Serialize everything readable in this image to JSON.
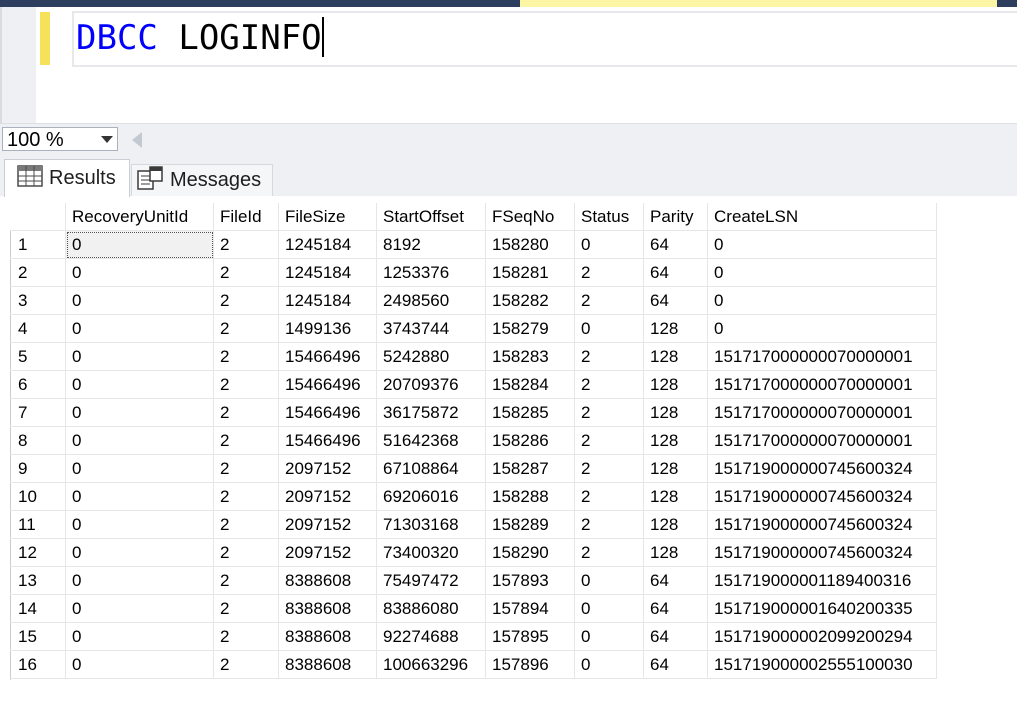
{
  "editor": {
    "keyword": "DBCC",
    "rest": " LOGINFO"
  },
  "zoom": {
    "value": "100 %"
  },
  "tabs": {
    "results": "Results",
    "messages": "Messages"
  },
  "colors": {
    "keyword": "#0000ff",
    "change_bar": "#f5e15a",
    "top_strip": "#2d3e5e"
  },
  "grid": {
    "columns": [
      "",
      "RecoveryUnitId",
      "FileId",
      "FileSize",
      "StartOffset",
      "FSeqNo",
      "Status",
      "Parity",
      "CreateLSN"
    ],
    "rows": [
      [
        "1",
        "0",
        "2",
        "1245184",
        "8192",
        "158280",
        "0",
        "64",
        "0"
      ],
      [
        "2",
        "0",
        "2",
        "1245184",
        "1253376",
        "158281",
        "2",
        "64",
        "0"
      ],
      [
        "3",
        "0",
        "2",
        "1245184",
        "2498560",
        "158282",
        "2",
        "64",
        "0"
      ],
      [
        "4",
        "0",
        "2",
        "1499136",
        "3743744",
        "158279",
        "0",
        "128",
        "0"
      ],
      [
        "5",
        "0",
        "2",
        "15466496",
        "5242880",
        "158283",
        "2",
        "128",
        "151717000000070000001"
      ],
      [
        "6",
        "0",
        "2",
        "15466496",
        "20709376",
        "158284",
        "2",
        "128",
        "151717000000070000001"
      ],
      [
        "7",
        "0",
        "2",
        "15466496",
        "36175872",
        "158285",
        "2",
        "128",
        "151717000000070000001"
      ],
      [
        "8",
        "0",
        "2",
        "15466496",
        "51642368",
        "158286",
        "2",
        "128",
        "151717000000070000001"
      ],
      [
        "9",
        "0",
        "2",
        "2097152",
        "67108864",
        "158287",
        "2",
        "128",
        "151719000000745600324"
      ],
      [
        "10",
        "0",
        "2",
        "2097152",
        "69206016",
        "158288",
        "2",
        "128",
        "151719000000745600324"
      ],
      [
        "11",
        "0",
        "2",
        "2097152",
        "71303168",
        "158289",
        "2",
        "128",
        "151719000000745600324"
      ],
      [
        "12",
        "0",
        "2",
        "2097152",
        "73400320",
        "158290",
        "2",
        "128",
        "151719000000745600324"
      ],
      [
        "13",
        "0",
        "2",
        "8388608",
        "75497472",
        "157893",
        "0",
        "64",
        "151719000001189400316"
      ],
      [
        "14",
        "0",
        "2",
        "8388608",
        "83886080",
        "157894",
        "0",
        "64",
        "151719000001640200335"
      ],
      [
        "15",
        "0",
        "2",
        "8388608",
        "92274688",
        "157895",
        "0",
        "64",
        "151719000002099200294"
      ],
      [
        "16",
        "0",
        "2",
        "8388608",
        "100663296",
        "157896",
        "0",
        "64",
        "151719000002555100030"
      ]
    ]
  }
}
